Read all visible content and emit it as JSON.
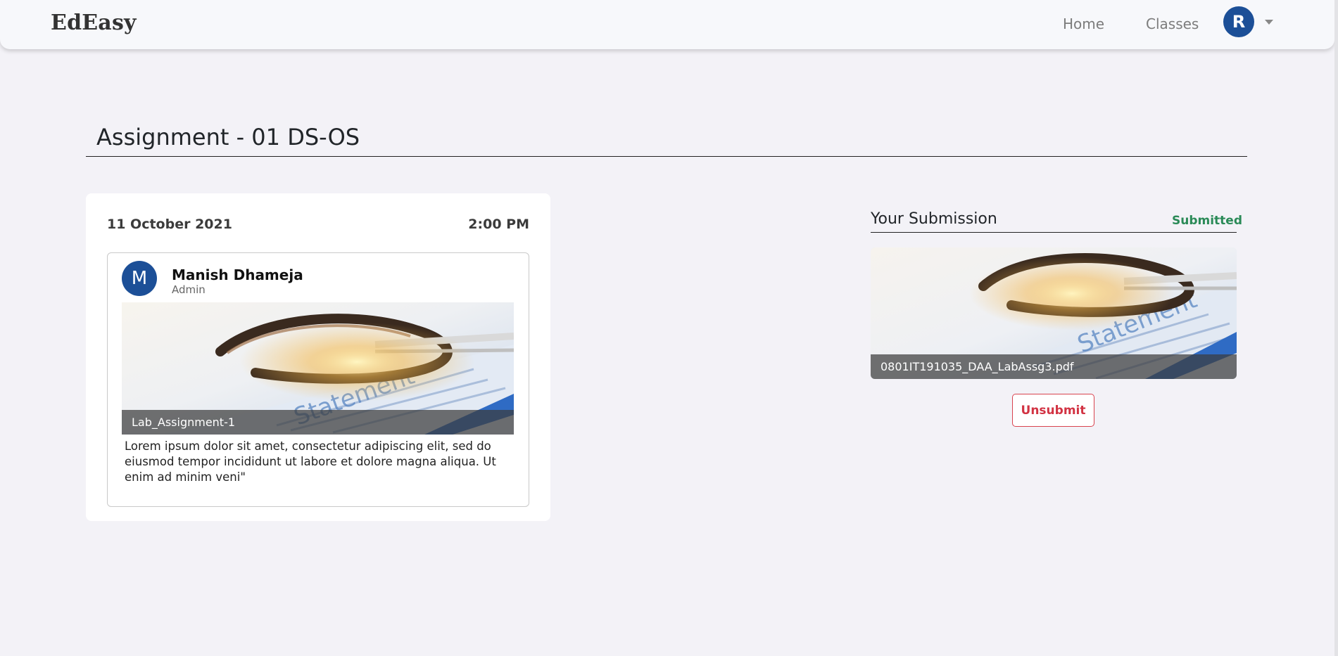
{
  "navbar": {
    "brand": "EdEasy",
    "links": [
      "Home",
      "Classes"
    ],
    "user_initial": "R"
  },
  "page": {
    "title": "Assignment - 01 DS-OS"
  },
  "assignment_card": {
    "date": "11 October 2021",
    "time": "2:00 PM",
    "author": {
      "initial": "M",
      "name": "Manish Dhameja",
      "role": "Admin"
    },
    "attachment_name": "Lab_Assignment-1",
    "description": "Lorem ipsum dolor sit amet, consectetur adipiscing elit, sed do eiusmod tempor incididunt ut labore et dolore magna aliqua. Ut enim ad minim veni\""
  },
  "submission": {
    "title": "Your Submission",
    "status": "Submitted",
    "file_name": "0801IT191035_DAA_LabAssg3.pdf",
    "unsubmit_label": "Unsubmit"
  },
  "colors": {
    "accent": "#1c4f97",
    "status_submitted": "#2a8a57",
    "danger": "#d23343",
    "background": "#f3f2f7"
  },
  "icons": {
    "dropdown": "chevron-down-icon"
  }
}
